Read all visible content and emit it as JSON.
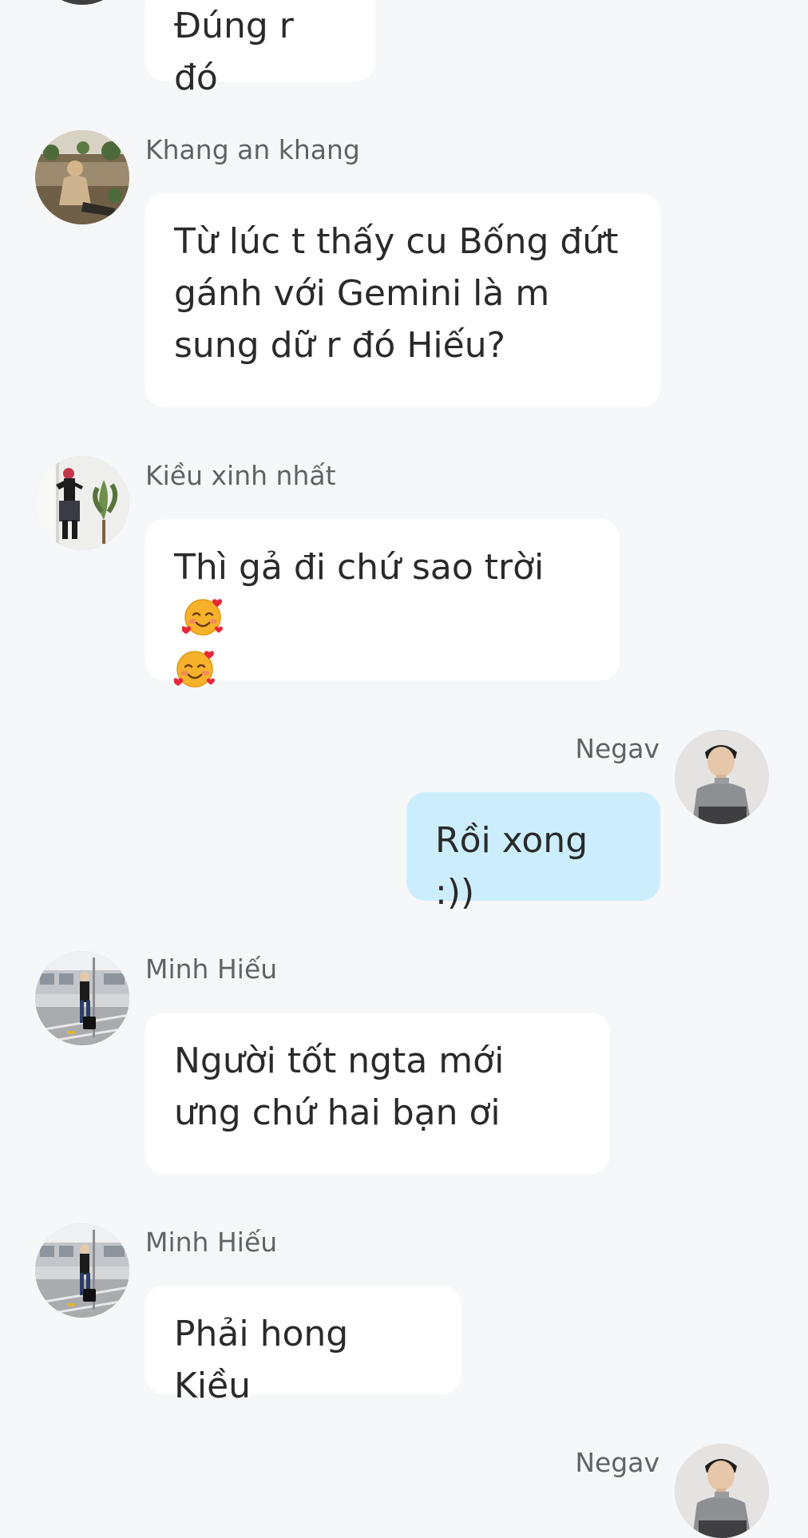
{
  "messages": [
    {
      "sender": "",
      "text": "Đúng r đó",
      "emojis": 0
    },
    {
      "sender": "Khang an khang",
      "text": "Từ lúc t thấy cu Bống đứt gánh với Gemini là m sung dữ r đó Hiếu?",
      "emojis": 0
    },
    {
      "sender": "Kiều xinh nhất",
      "text": "Thì gả đi chứ sao trời",
      "emojis": 2,
      "emoji_name": "smiling-face-with-hearts"
    },
    {
      "sender": "Negav",
      "text": "Rồi xong :))",
      "emojis": 0
    },
    {
      "sender": "Minh Hiếu",
      "text": "Người tốt ngta mới ưng chứ hai bạn ơi",
      "emojis": 0
    },
    {
      "sender": "Minh Hiếu",
      "text": "Phải hong Kiều",
      "emojis": 0
    },
    {
      "sender": "Negav",
      "text": "",
      "emojis": 0
    }
  ],
  "colors": {
    "background": "#f6f7f9",
    "incoming_bubble": "#ffffff",
    "outgoing_bubble": "#cceefc",
    "sender_name": "#5f6368",
    "message_text": "#2a2a2a"
  }
}
